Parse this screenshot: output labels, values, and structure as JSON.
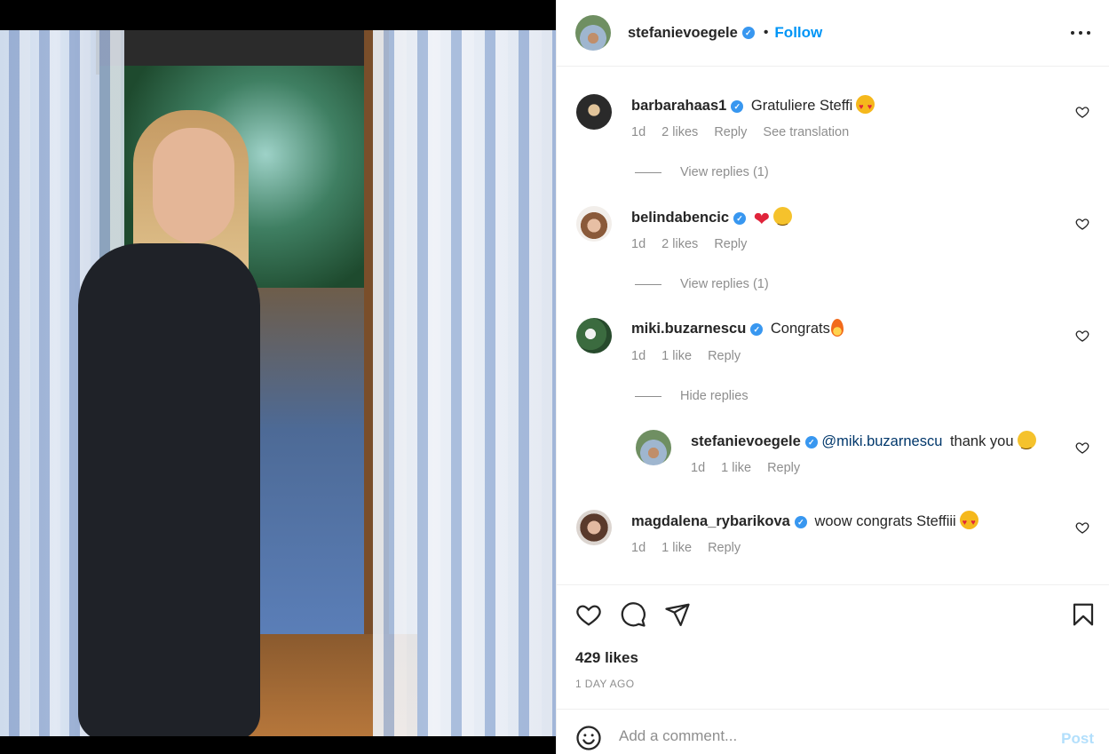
{
  "post": {
    "author": "stefanievoegele",
    "dot": "•",
    "follow_label": "Follow",
    "likes_text": "429 likes",
    "age_text": "1 DAY AGO"
  },
  "comments": [
    {
      "user": "barbarahaas1",
      "text": "Gratuliere Steffi",
      "emojis": [
        "smiling-face-with-heart-eyes"
      ],
      "time": "1d",
      "likes": "2 likes",
      "reply_label": "Reply",
      "translate_label": "See translation",
      "replies_toggle": "View replies (1)"
    },
    {
      "user": "belindabencic",
      "text": "",
      "emojis": [
        "red-heart",
        "smiling-face"
      ],
      "time": "1d",
      "likes": "2 likes",
      "reply_label": "Reply",
      "replies_toggle": "View replies (1)"
    },
    {
      "user": "miki.buzarnescu",
      "text": "Congrats",
      "emojis": [
        "fire"
      ],
      "time": "1d",
      "likes": "1 like",
      "reply_label": "Reply",
      "replies_toggle": "Hide replies",
      "reply": {
        "user": "stefanievoegele",
        "mention": "@miki.buzarnescu",
        "text": "thank you",
        "emojis": [
          "smiling-face"
        ],
        "time": "1d",
        "likes": "1 like",
        "reply_label": "Reply"
      }
    },
    {
      "user": "magdalena_rybarikova",
      "text": "woow congrats Steffiii",
      "emojis": [
        "smiling-face-with-heart-eyes"
      ],
      "time": "1d",
      "likes": "1 like",
      "reply_label": "Reply"
    }
  ],
  "composer": {
    "placeholder": "Add a comment...",
    "post_label": "Post"
  },
  "colors": {
    "link_blue": "#0095f6",
    "verified_blue": "#3897f0",
    "muted_gray": "#8e8e8e",
    "post_disabled": "#b2dffc"
  }
}
